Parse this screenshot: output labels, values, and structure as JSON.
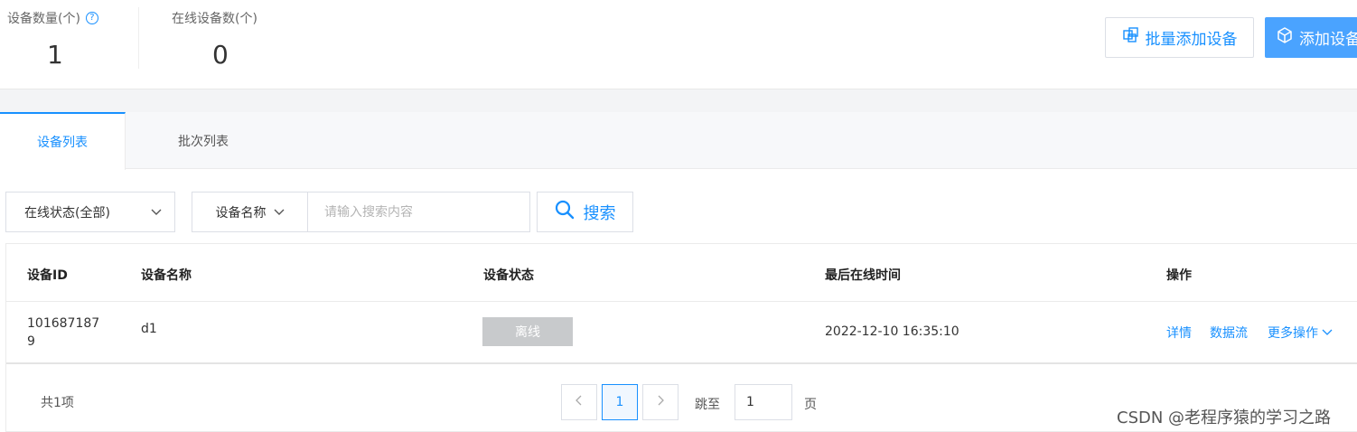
{
  "stats": {
    "device_count_label": "设备数量(个)",
    "device_count_value": "1",
    "online_count_label": "在线设备数(个)",
    "online_count_value": "0",
    "help_glyph": "?"
  },
  "actions": {
    "batch_add_label": "批量添加设备",
    "add_label": "添加设备"
  },
  "tabs": [
    {
      "label": "设备列表",
      "active": true
    },
    {
      "label": "批次列表",
      "active": false
    }
  ],
  "filters": {
    "status_select_value": "在线状态(全部)",
    "field_select_value": "设备名称",
    "search_placeholder": "请输入搜索内容",
    "search_button_label": "搜索"
  },
  "table": {
    "columns": [
      "设备ID",
      "设备名称",
      "设备状态",
      "最后在线时间",
      "操作"
    ],
    "rows": [
      {
        "id_line1": "101687187",
        "id_line2": "9",
        "name": "d1",
        "status": "离线",
        "last_online": "2022-12-10 16:35:10",
        "actions": [
          "详情",
          "数据流",
          "更多操作"
        ]
      }
    ]
  },
  "pagination": {
    "total_text": "共1项",
    "current_page": "1",
    "jump_label": "跳至",
    "jump_value": "1",
    "page_suffix": "页"
  },
  "watermark": "CSDN @老程序猿的学习之路",
  "colors": {
    "accent": "#1890ff",
    "primary_button": "#4aa3ff",
    "offline_badge": "#c8cacc"
  }
}
